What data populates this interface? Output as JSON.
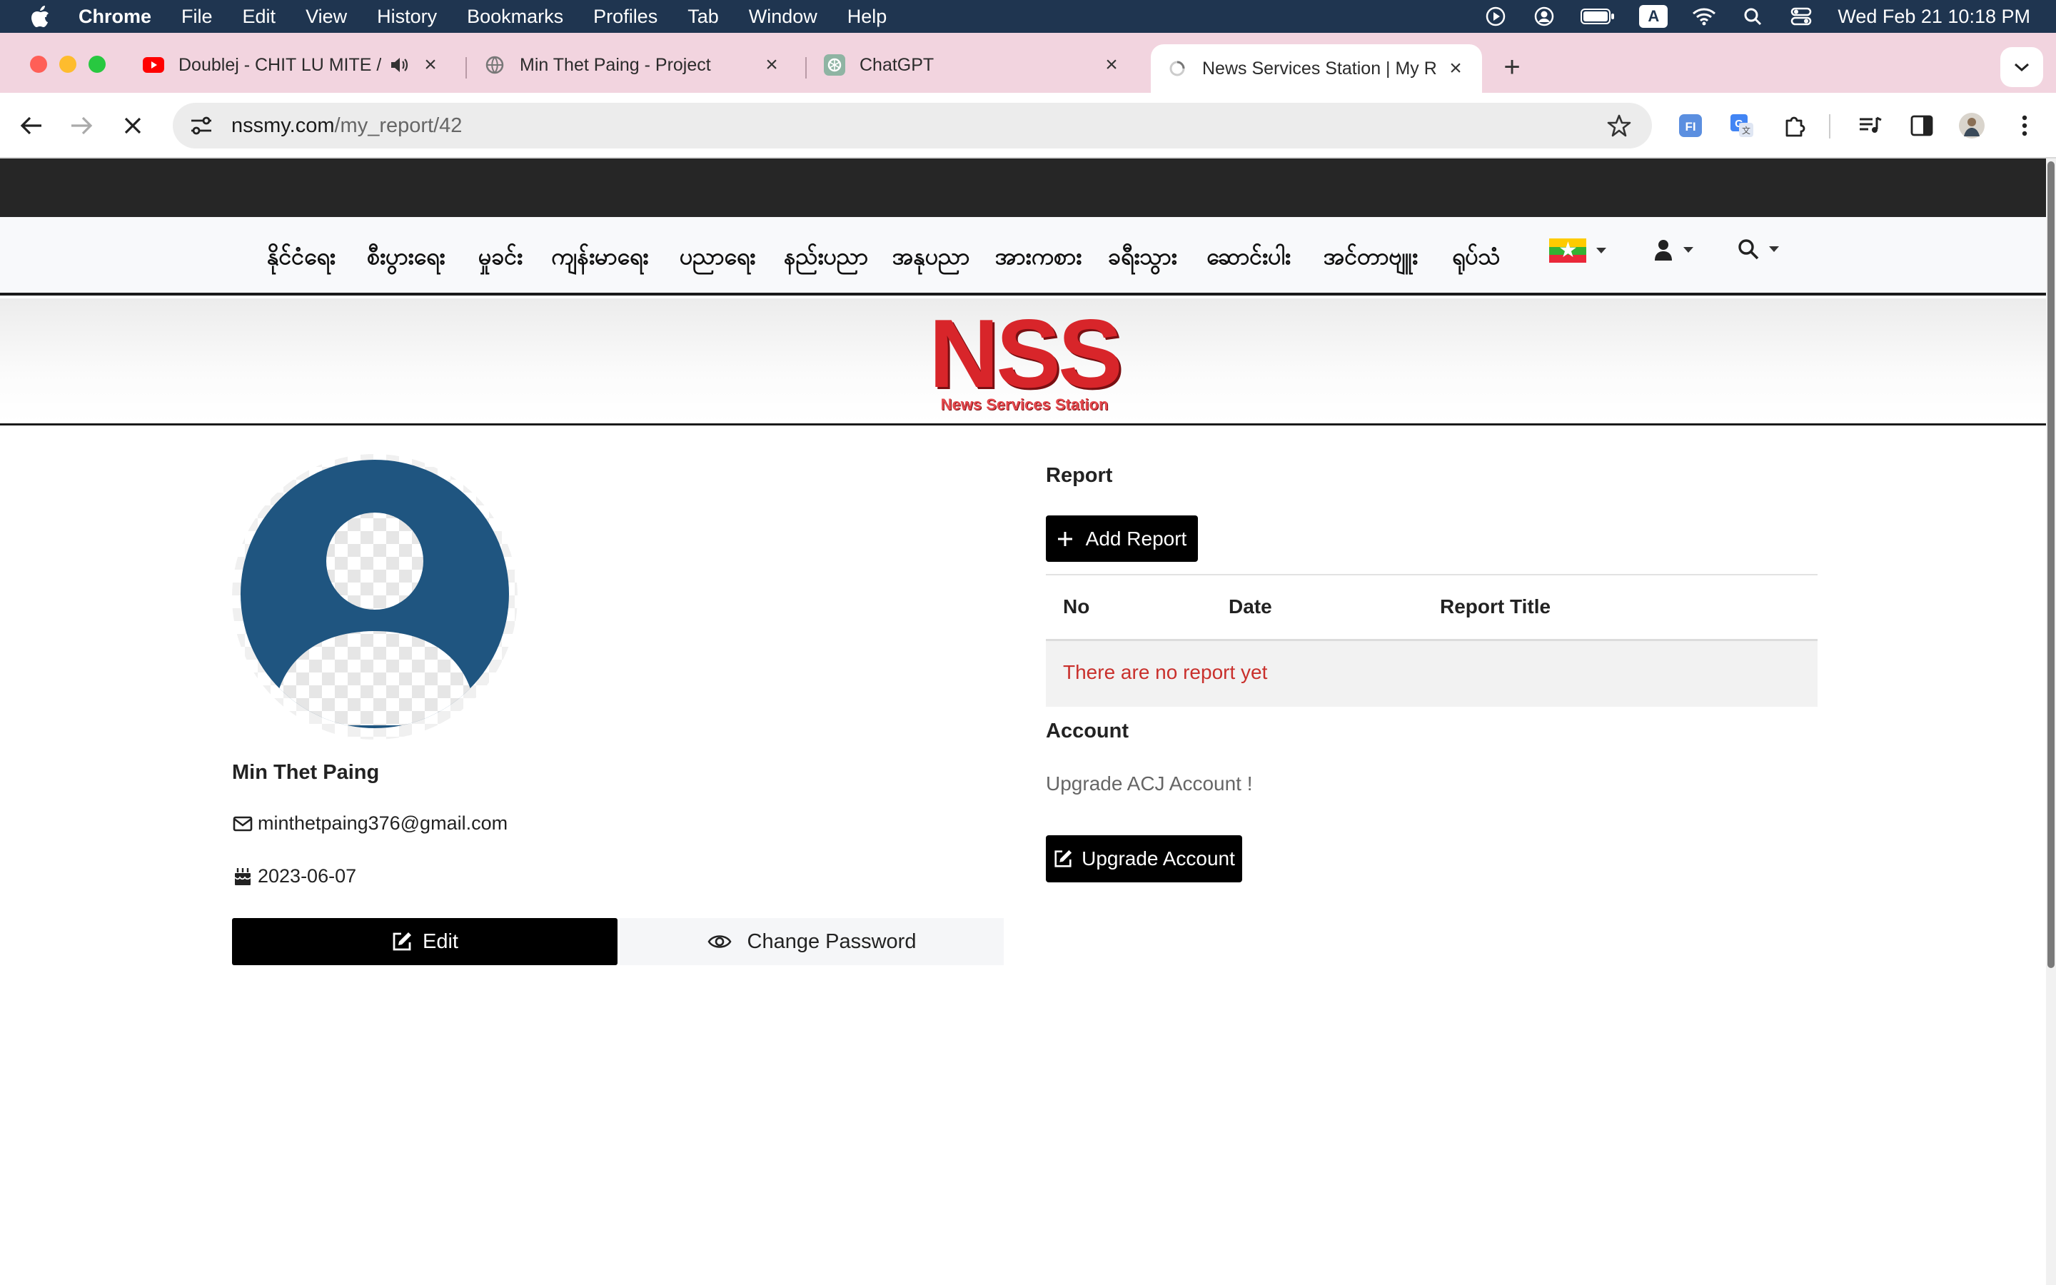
{
  "menubar": {
    "app_name": "Chrome",
    "items": [
      "File",
      "Edit",
      "View",
      "History",
      "Bookmarks",
      "Profiles",
      "Tab",
      "Window",
      "Help"
    ],
    "keyboard_input": "A",
    "clock": "Wed Feb 21  10:18 PM"
  },
  "tabs": [
    {
      "title": "Doublej - CHIT LU MITE //",
      "favicon": "youtube-icon"
    },
    {
      "title": "Min Thet Paing - Project",
      "favicon": "globe-icon"
    },
    {
      "title": "ChatGPT",
      "favicon": "chatgpt-icon"
    },
    {
      "title": "News Services Station | My R",
      "favicon": "loading-icon",
      "active": true
    }
  ],
  "address_bar": {
    "host": "nssmy.com",
    "path": "/my_report/42"
  },
  "site": {
    "categories": [
      "နိုင်ငံရေး",
      "စီးပွားရေး",
      "မှုခင်း",
      "ကျန်းမာရေး",
      "ပညာရေး",
      "နည်းပညာ",
      "အနုပညာ",
      "အားကစား",
      "ခရီးသွား",
      "ဆောင်းပါး",
      "အင်တာဗျူး",
      "ရုပ်သံ"
    ],
    "logo_text": "NSS",
    "logo_tagline": "News Services Station"
  },
  "profile": {
    "name": "Min Thet Paing",
    "email": "minthetpaing376@gmail.com",
    "birthday": "2023-06-07",
    "edit_label": "Edit",
    "change_password_label": "Change Password"
  },
  "report": {
    "heading": "Report",
    "add_label": "Add Report",
    "columns": [
      "No",
      "Date",
      "Report Title"
    ],
    "empty_message": "There are no report yet"
  },
  "account": {
    "heading": "Account",
    "upgrade_text": "Upgrade ACJ Account !",
    "upgrade_label": "Upgrade Account"
  },
  "colors": {
    "brand_red": "#d8252a",
    "empty_message_red": "#c9302c",
    "avatar_blue": "#1f5580",
    "tab_strip_pink": "#f2d4df"
  }
}
